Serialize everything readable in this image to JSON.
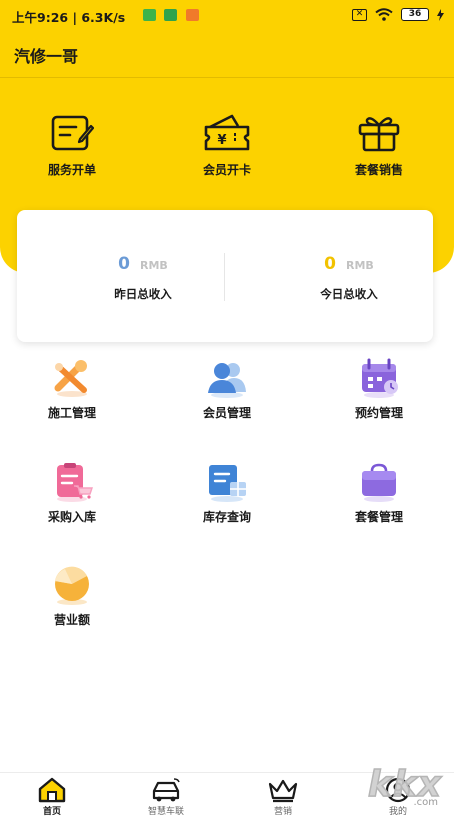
{
  "status_bar": {
    "time_text": "上午9:26 | 6.3K/s",
    "sim_label": "✕",
    "battery_text": "36"
  },
  "header": {
    "title": "汽修一哥"
  },
  "quick_actions": [
    {
      "label": "服务开单",
      "icon": "service-order-icon"
    },
    {
      "label": "会员开卡",
      "icon": "member-card-icon"
    },
    {
      "label": "套餐销售",
      "icon": "gift-icon"
    }
  ],
  "income": {
    "yesterday": {
      "value": "0",
      "unit": "RMB",
      "label": "昨日总收入",
      "color": "#6b9bd6"
    },
    "today": {
      "value": "0",
      "unit": "RMB",
      "label": "今日总收入",
      "color": "#f2c200"
    }
  },
  "features": [
    {
      "label": "施工管理",
      "icon": "wrench-icon"
    },
    {
      "label": "会员管理",
      "icon": "members-icon"
    },
    {
      "label": "预约管理",
      "icon": "calendar-icon"
    },
    {
      "label": "采购入库",
      "icon": "purchase-icon"
    },
    {
      "label": "库存查询",
      "icon": "inventory-icon"
    },
    {
      "label": "套餐管理",
      "icon": "package-icon"
    },
    {
      "label": "营业额",
      "icon": "pie-chart-icon"
    }
  ],
  "bottom_nav": [
    {
      "label": "首页",
      "icon": "home-icon",
      "active": true
    },
    {
      "label": "智慧车联",
      "icon": "car-icon",
      "active": false
    },
    {
      "label": "营销",
      "icon": "crown-icon",
      "active": false
    },
    {
      "label": "我的",
      "icon": "profile-icon",
      "active": false
    }
  ],
  "watermark": {
    "text": "kkx",
    "sub": ".com"
  },
  "colors": {
    "brand_yellow": "#fcd200"
  }
}
